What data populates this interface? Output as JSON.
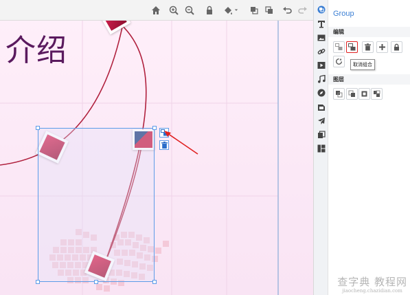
{
  "canvas": {
    "heading_text": "介绍"
  },
  "panel": {
    "title": "Group",
    "section_edit": "编辑",
    "section_layers": "图层",
    "tooltip_ungroup": "取消组合"
  },
  "watermark": {
    "line1": "查字典 教程网",
    "line2": "jiaocheng.chazidian.com"
  },
  "colors": {
    "accent_blue": "#3b7fd4",
    "selection_blue": "#5b9be8",
    "curve_red": "#b0213e",
    "highlight_red": "#e02020",
    "heading_purple": "#5a1a5e",
    "pixel_heart_pink": "#f4c6d6"
  },
  "icons": {
    "toolbar": [
      "home-icon",
      "zoom-in-icon",
      "zoom-out-icon",
      "lock-icon",
      "fill-bucket-icon",
      "bring-front-icon",
      "send-back-icon",
      "undo-icon",
      "redo-icon"
    ],
    "sidebar": [
      "component-icon",
      "text-icon",
      "image-icon",
      "link-icon",
      "video-icon",
      "music-icon",
      "compass-icon",
      "shape-icon",
      "airplane-icon",
      "layers-icon",
      "template-icon"
    ],
    "edit": [
      "group-icon",
      "ungroup-icon",
      "delete-icon",
      "add-icon",
      "lock-icon",
      "rotate-icon"
    ],
    "layers": [
      "bring-to-front-icon",
      "bring-forward-icon",
      "send-backward-icon",
      "send-to-back-icon"
    ]
  }
}
